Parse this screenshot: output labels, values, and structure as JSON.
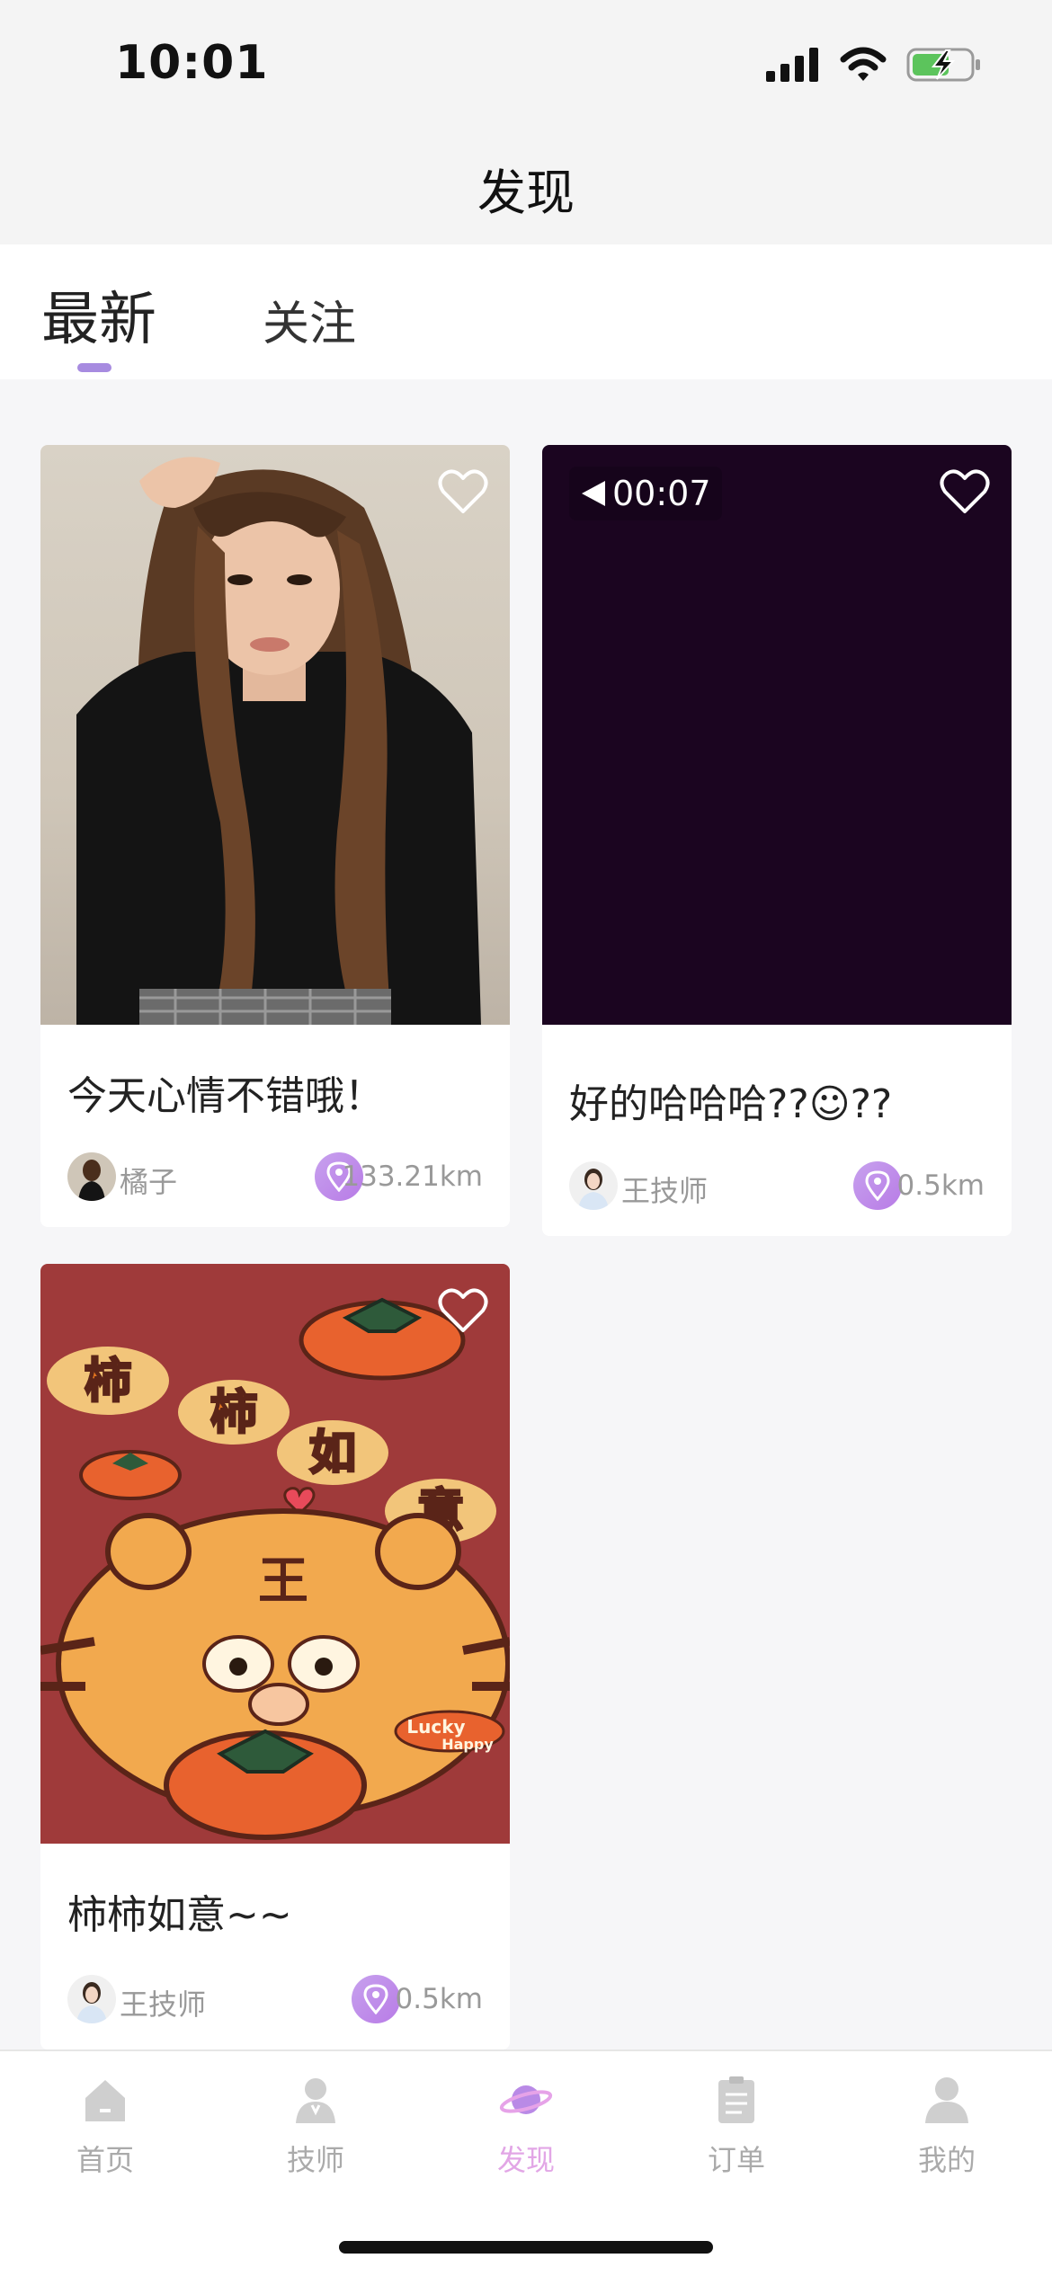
{
  "status_bar": {
    "time": "10:01"
  },
  "nav": {
    "title": "发现"
  },
  "tabs": [
    {
      "label": "最新",
      "active": true
    },
    {
      "label": "关注",
      "active": false
    }
  ],
  "posts": [
    {
      "title": "今天心情不错哦！",
      "author": "橘子",
      "distance": "133.21km",
      "type": "photo"
    },
    {
      "title": "好的哈哈哈??☺??",
      "author": "王技师",
      "distance": "0.5km",
      "type": "video",
      "duration": "00:07"
    },
    {
      "title": "柿柿如意~~",
      "author": "王技师",
      "distance": "0.5km",
      "type": "photo"
    }
  ],
  "sticker_text": {
    "chars": [
      "柿",
      "柿",
      "如",
      "意"
    ],
    "lucky": "Lucky",
    "happy": "Happy",
    "tiger_mark": "王"
  },
  "tab_bar": [
    {
      "label": "首页",
      "icon": "home-icon",
      "active": false
    },
    {
      "label": "技师",
      "icon": "technician-icon",
      "active": false
    },
    {
      "label": "发现",
      "icon": "planet-icon",
      "active": true
    },
    {
      "label": "订单",
      "icon": "order-icon",
      "active": false
    },
    {
      "label": "我的",
      "icon": "profile-icon",
      "active": false
    }
  ],
  "colors": {
    "accent": "#a78be0",
    "tab_active": "#e2a6e6",
    "video_bg": "#1b0520",
    "card3_bg": "#9f3a3a"
  }
}
